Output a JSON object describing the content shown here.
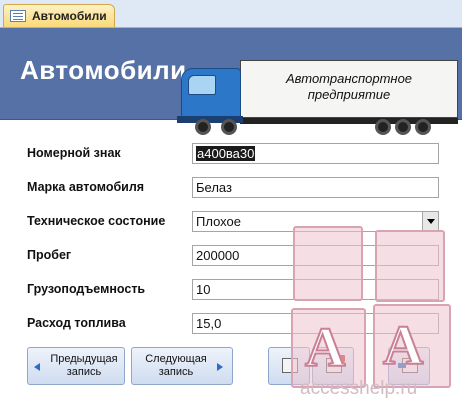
{
  "tab": {
    "label": "Автомобили",
    "icon": "form-icon"
  },
  "header": {
    "title": "Автомобили",
    "banner_text_line1": "Автотранспортное",
    "banner_text_line2": "предприятие",
    "background_color": "#5571a6"
  },
  "form": {
    "fields": [
      {
        "label": "Номерной знак",
        "value": "а400ва30",
        "selected": true
      },
      {
        "label": "Марка автомобиля",
        "value": "Белаз"
      },
      {
        "label": "Техническое состоние",
        "value": "Плохое",
        "type": "dropdown"
      },
      {
        "label": "Пробег",
        "value": "200000"
      },
      {
        "label": "Грузоподъемность",
        "value": "10"
      },
      {
        "label": "Расход топлива",
        "value": "15,0"
      }
    ]
  },
  "buttons": {
    "prev_line1": "Предыдущая",
    "prev_line2": "запись",
    "next_line1": "Следующая",
    "next_line2": "запись",
    "icons": [
      "new-record-icon",
      "delete-record-icon",
      "close-form-icon"
    ]
  },
  "watermark": {
    "text": "accesshelp.ru",
    "letter": "A"
  }
}
